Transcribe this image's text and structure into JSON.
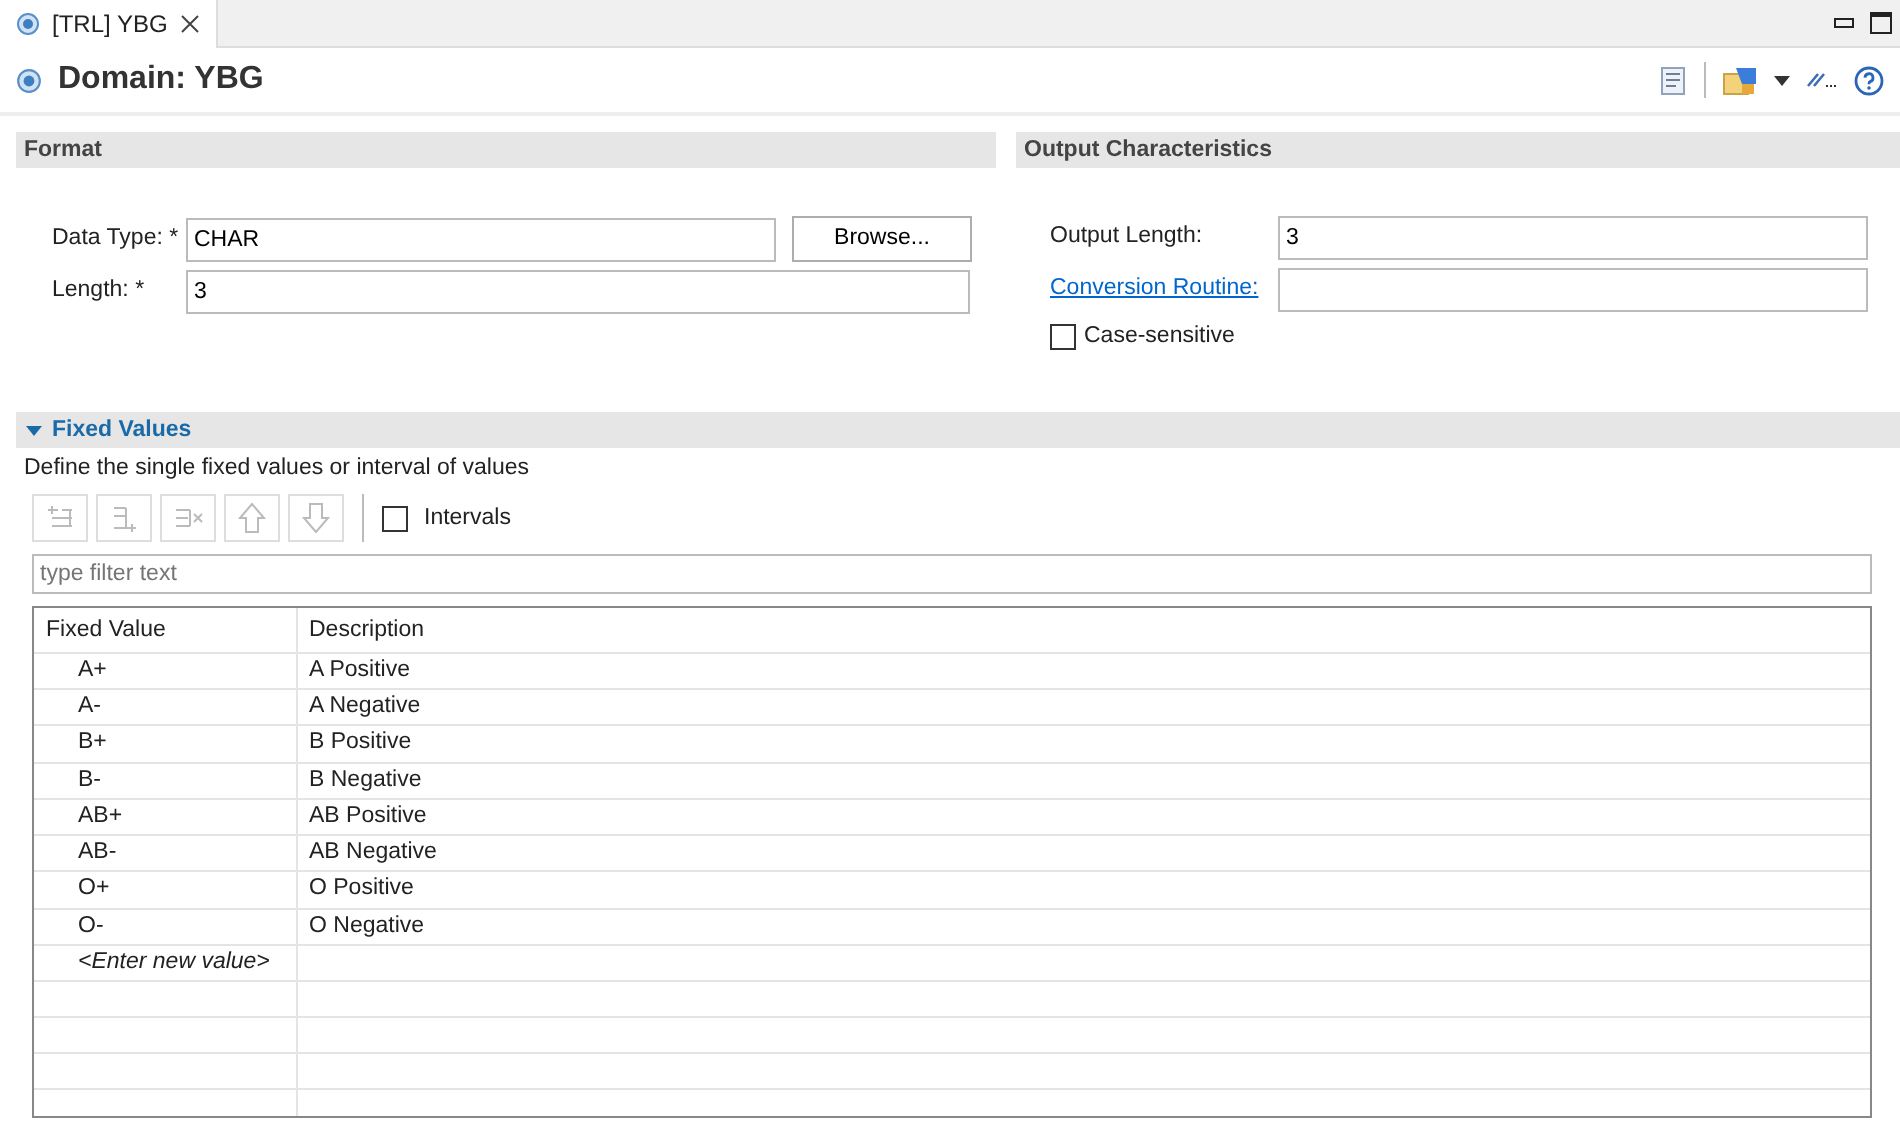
{
  "tab": {
    "label": "[TRL] YBG",
    "selected": true
  },
  "title": "Domain: YBG",
  "format": {
    "heading": "Format",
    "data_type_label": "Data Type: *",
    "data_type": "CHAR",
    "browse": "Browse...",
    "length_label": "Length: *",
    "length": "3"
  },
  "output": {
    "heading": "Output Characteristics",
    "output_length_label": "Output Length:",
    "output_length": "3",
    "conversion_label": "Conversion Routine:",
    "case_sensitive": {
      "label": "Case-sensitive",
      "checked": false
    }
  },
  "fixed_values": {
    "heading": "Fixed Values",
    "expanded": true,
    "description": "Define the single fixed values or interval of values",
    "intervals": {
      "label": "Intervals",
      "checked": false
    },
    "filter_placeholder": "type filter text",
    "columns": [
      "Fixed Value",
      "Description"
    ],
    "rows": [
      {
        "value": "A+",
        "description": "A Positive"
      },
      {
        "value": "A-",
        "description": "A Negative"
      },
      {
        "value": "B+",
        "description": "B Positive"
      },
      {
        "value": "B-",
        "description": "B Negative"
      },
      {
        "value": "AB+",
        "description": "AB Positive"
      },
      {
        "value": "AB-",
        "description": "AB Negative"
      },
      {
        "value": "O+",
        "description": "O Positive"
      },
      {
        "value": "O-",
        "description": "O Negative"
      }
    ],
    "new_value_hint": "<Enter new value>"
  }
}
